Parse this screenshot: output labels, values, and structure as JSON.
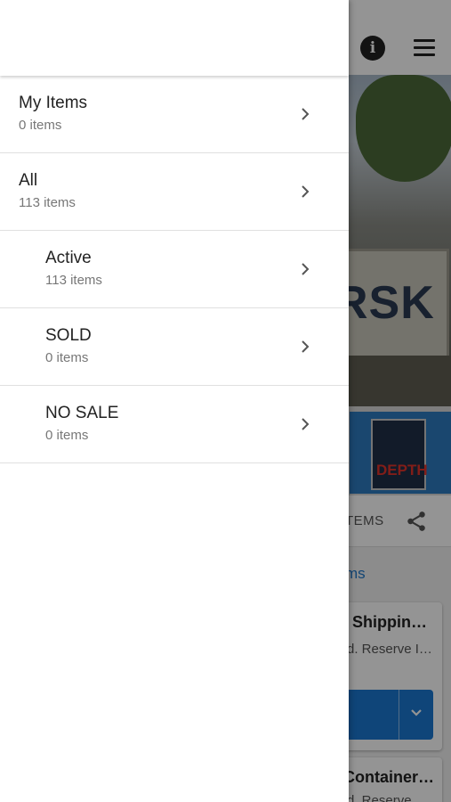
{
  "background_page": {
    "info_icon": "info-icon",
    "menu_icon": "hamburger-menu-icon",
    "hero_image_text": "RSK",
    "thumbnail_text": "DEPTH",
    "tab_label": "TEMS",
    "share_icon": "share-icon",
    "link_text": "ms",
    "cards": [
      {
        "title": "Shippin…",
        "subtitle": "d. Reserve I…"
      },
      {
        "title": "Container…",
        "subtitle": "d. Reserve"
      }
    ],
    "bid_dropdown_icon": "chevron-down-icon",
    "accent_color": "#1a78d0"
  },
  "drawer": {
    "items": [
      {
        "title": "My Items",
        "count": "0 items",
        "level": 0
      },
      {
        "title": "All",
        "count": "113 items",
        "level": 0
      },
      {
        "title": "Active",
        "count": "113 items",
        "level": 1
      },
      {
        "title": "SOLD",
        "count": "0 items",
        "level": 1
      },
      {
        "title": "NO SALE",
        "count": "0 items",
        "level": 1
      }
    ],
    "chevron_icon": "chevron-right-icon"
  }
}
